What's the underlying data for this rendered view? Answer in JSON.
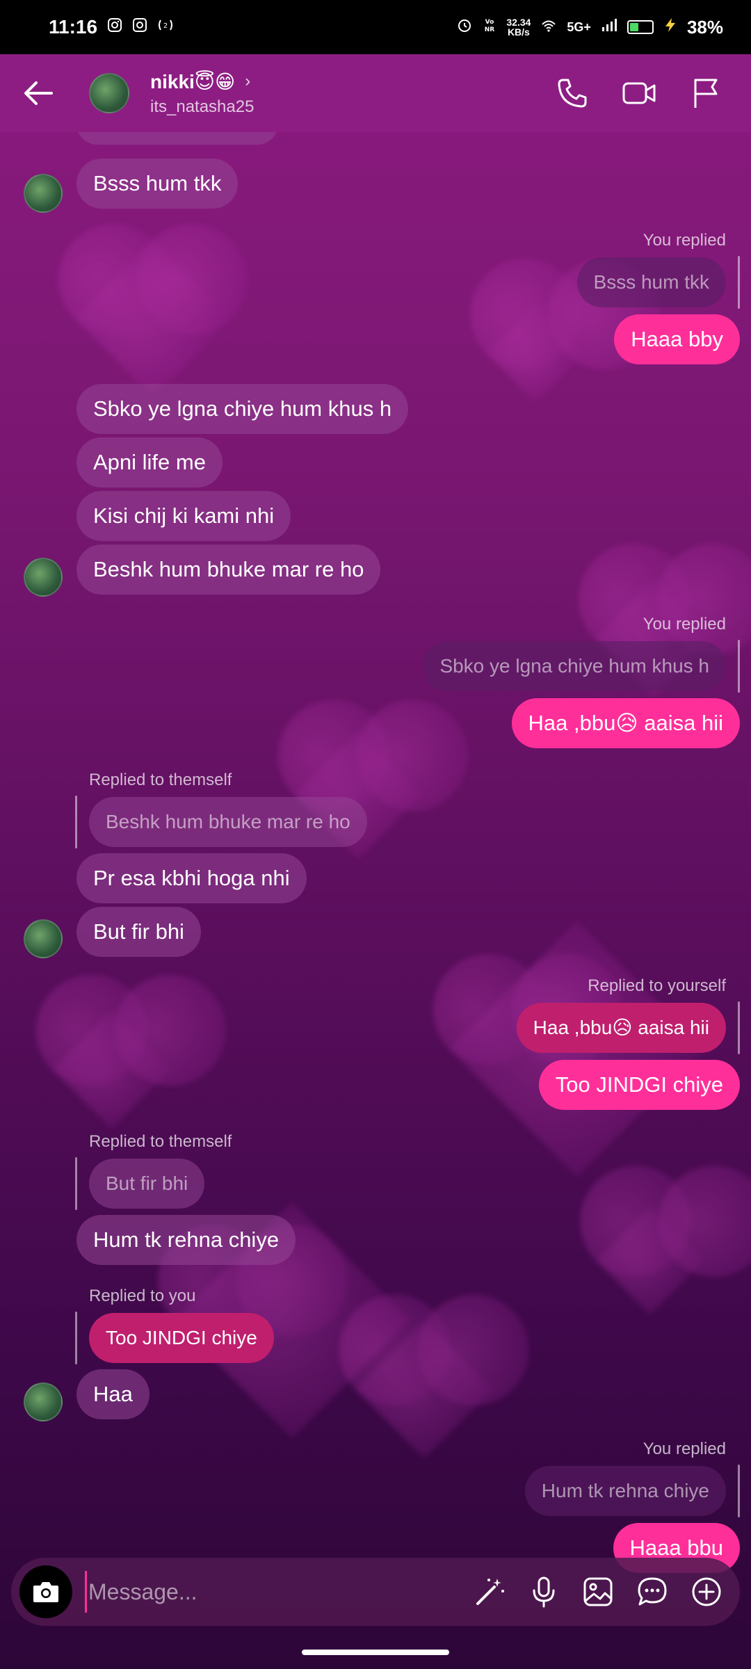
{
  "status_bar": {
    "time": "11:16",
    "speed_value": "32.34",
    "speed_unit": "KB/s",
    "network": "5G+",
    "battery_percent_text": "38%",
    "battery_level": 0.38
  },
  "header": {
    "name": "nikki😇😁",
    "username": "its_natasha25"
  },
  "messages": {
    "m1": "Bsss hum tkk",
    "reply1_label": "You replied",
    "reply1_preview": "Bsss hum tkk",
    "m2": "Haaa bby",
    "m3": "Sbko ye lgna chiye hum khus h",
    "m4": "Apni life me",
    "m5": "Kisi chij ki kami nhi",
    "m6": "Beshk hum bhuke mar re ho",
    "reply2_label": "You replied",
    "reply2_preview": "Sbko ye lgna chiye hum khus h",
    "m7": "Haa ,bbu😥 aaisa hii",
    "reply3_label": "Replied to themself",
    "reply3_preview": "Beshk hum bhuke mar re ho",
    "m8": "Pr esa kbhi hoga nhi",
    "m9": "But fir bhi",
    "reply4_label": "Replied to yourself",
    "reply4_preview": "Haa ,bbu😥 aaisa hii",
    "m10": "Too JINDGI chiye",
    "reply5_label": "Replied to themself",
    "reply5_preview": "But fir bhi",
    "m11": "Hum tk rehna chiye",
    "reply6_label": "Replied to you",
    "reply6_preview": "Too JINDGI chiye",
    "m12": "Haa",
    "reply7_label": "You replied",
    "reply7_preview": "Hum tk rehna chiye",
    "m13": "Haaa bbu"
  },
  "composer": {
    "placeholder": "Message..."
  },
  "icons": {
    "back": "back-arrow-icon",
    "call": "phone-icon",
    "video": "video-camera-icon",
    "report": "flag-icon",
    "camera": "camera-icon",
    "magic": "magic-wand-icon",
    "mic": "microphone-icon",
    "gallery": "gallery-icon",
    "sticker": "chat-sticker-icon",
    "more": "plus-circle-icon"
  },
  "colors": {
    "header_bg": "#8d1d83",
    "outgoing_bubble": "#ff2f9a",
    "incoming_bubble": "#9a4a96"
  }
}
